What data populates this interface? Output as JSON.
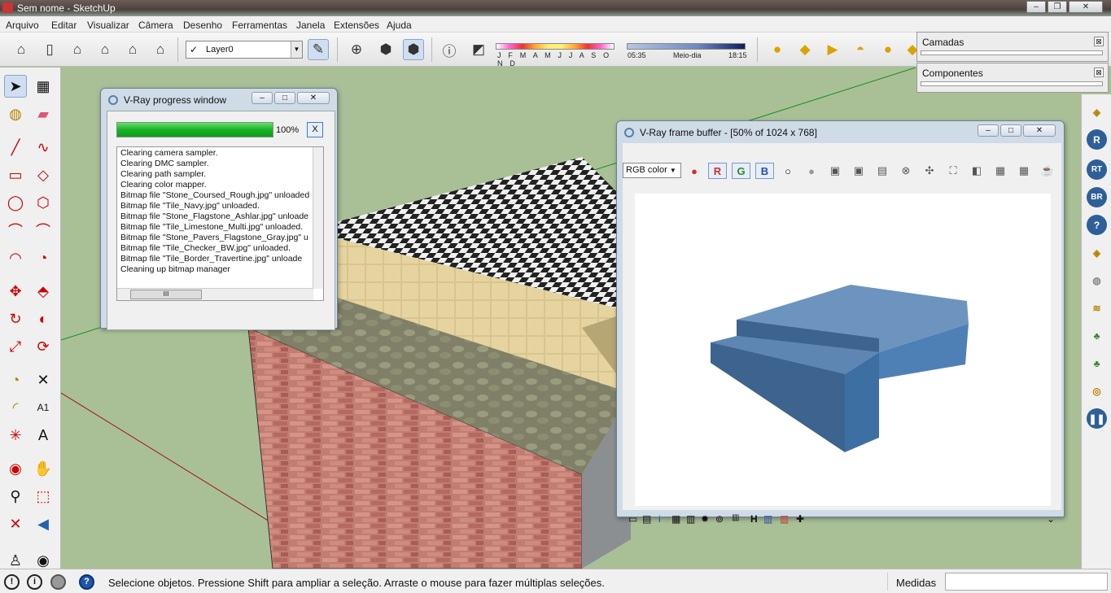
{
  "app": {
    "title": "Sem nome - SketchUp"
  },
  "menu": [
    "Arquivo",
    "Editar",
    "Visualizar",
    "Câmera",
    "Desenho",
    "Ferramentas",
    "Janela",
    "Extensões",
    "Ajuda"
  ],
  "toolbar": {
    "layer_value": "Layer0",
    "months_label": "J F M A M J J A S O N D",
    "time_start": "05:35",
    "time_mid": "Meio-dia",
    "time_end": "18:15"
  },
  "trays": {
    "layers_title": "Camadas",
    "components_title": "Componentes"
  },
  "vray_progress": {
    "title": "V-Ray progress window",
    "progress": 1.0,
    "percent_label": "100%",
    "cancel_label": "X",
    "log": [
      "Clearing camera sampler.",
      "Clearing DMC sampler.",
      "Clearing path sampler.",
      "Clearing color mapper.",
      "Bitmap file \"Stone_Coursed_Rough.jpg\" unloaded",
      "Bitmap file \"Tile_Navy.jpg\" unloaded.",
      "Bitmap file \"Stone_Flagstone_Ashlar.jpg\" unloade",
      "Bitmap file \"Tile_Limestone_Multi.jpg\" unloaded.",
      "Bitmap file \"Stone_Pavers_Flagstone_Gray.jpg\" u",
      "Bitmap file \"Tile_Checker_BW.jpg\" unloaded.",
      "Bitmap file \"Tile_Border_Travertine.jpg\" unloade",
      "Cleaning up bitmap manager"
    ],
    "scroll_grip": "III"
  },
  "vray_fb": {
    "title": "V-Ray frame buffer - [50% of 1024 x 768]",
    "channel": "RGB color",
    "r": "R",
    "g": "G",
    "b": "B",
    "bottom_h": "H",
    "bottom_i": "i"
  },
  "status": {
    "message": "Selecione objetos. Pressione Shift para ampliar a seleção. Arraste o mouse para fazer múltiplas seleções.",
    "measures_label": "Medidas",
    "measures_value": ""
  },
  "right_tools": [
    "R",
    "RT",
    "BR"
  ],
  "colors": {
    "viewport_bg": "#a9c097",
    "progress_green": "#19b226",
    "vray_object": "#4e79a3"
  }
}
